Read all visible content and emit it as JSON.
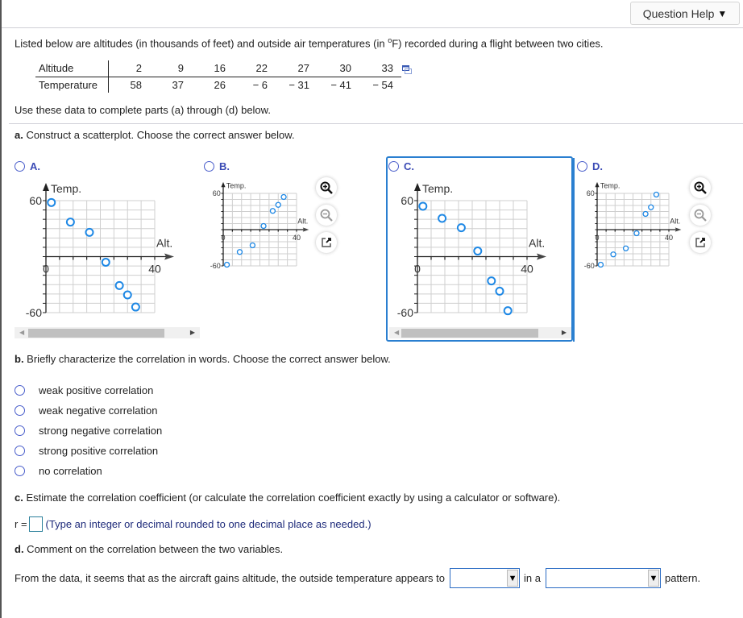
{
  "header": {
    "question_help_label": "Question Help",
    "question_help_icon": "caret-down-icon"
  },
  "intro": {
    "text_before_degree": "Listed below are altitudes (in thousands of feet) and outside air temperatures (in ",
    "degree": "o",
    "text_after_degree": "F) recorded during a flight between two cities."
  },
  "table": {
    "row_labels": [
      "Altitude",
      "Temperature"
    ],
    "altitude": [
      "2",
      "9",
      "16",
      "22",
      "27",
      "30",
      "33"
    ],
    "temperature": [
      "58",
      "37",
      "26",
      "− 6",
      "− 31",
      "− 41",
      "− 54"
    ],
    "copy_icon": "copy-data-icon"
  },
  "use_text": "Use these data to complete parts (a) through (d) below.",
  "part_a": {
    "prefix": "a.",
    "text": " Construct a scatterplot. Choose the correct answer below.",
    "options": [
      {
        "letter": "A.",
        "selected": false
      },
      {
        "letter": "B.",
        "selected": false
      },
      {
        "letter": "C.",
        "selected": false,
        "highlighted": true
      },
      {
        "letter": "D.",
        "selected": false
      }
    ],
    "zoom_in_icon": "zoom-in-icon",
    "zoom_out_icon": "zoom-out-icon",
    "popout_icon": "popout-icon"
  },
  "chart_data": [
    {
      "type": "scatter",
      "option": "A",
      "xlabel": "Alt.",
      "ylabel": "Temp.",
      "xlim": [
        0,
        40
      ],
      "ylim": [
        -60,
        60
      ],
      "grid": true,
      "xticks_labeled": [
        "0",
        "40"
      ],
      "yticks_labeled": [
        "60",
        "-60"
      ],
      "x": [
        2,
        9,
        16,
        22,
        27,
        30,
        33
      ],
      "y": [
        58,
        37,
        26,
        -6,
        -31,
        -41,
        -54
      ],
      "color": "#1e88e5"
    },
    {
      "type": "scatter",
      "option": "B",
      "xlabel": "Alt.",
      "ylabel": "Temp.",
      "xlim": [
        0,
        40
      ],
      "ylim": [
        -60,
        60
      ],
      "grid": true,
      "xticks_labeled": [
        "0",
        "40"
      ],
      "yticks_labeled": [
        "60",
        "-60"
      ],
      "x": [
        2,
        9,
        16,
        22,
        27,
        30,
        33
      ],
      "y": [
        -58,
        -37,
        -26,
        6,
        31,
        41,
        54
      ],
      "color": "#1e88e5"
    },
    {
      "type": "scatter",
      "option": "C",
      "xlabel": "Alt.",
      "ylabel": "Temp.",
      "xlim": [
        0,
        40
      ],
      "ylim": [
        -60,
        60
      ],
      "grid": true,
      "xticks_labeled": [
        "0",
        "40"
      ],
      "yticks_labeled": [
        "60",
        "-60"
      ],
      "x": [
        2,
        9,
        16,
        22,
        27,
        30,
        33
      ],
      "y": [
        54,
        41,
        31,
        6,
        -26,
        -37,
        -58
      ],
      "color": "#1e88e5"
    },
    {
      "type": "scatter",
      "option": "D",
      "xlabel": "Alt.",
      "ylabel": "Temp.",
      "xlim": [
        0,
        40
      ],
      "ylim": [
        -60,
        60
      ],
      "grid": true,
      "xticks_labeled": [
        "0",
        "40"
      ],
      "yticks_labeled": [
        "60",
        "-60"
      ],
      "x": [
        2,
        9,
        16,
        22,
        27,
        30,
        33
      ],
      "y": [
        -58,
        -41,
        -31,
        -6,
        26,
        37,
        58
      ],
      "color": "#1e88e5"
    }
  ],
  "part_b": {
    "prefix": "b.",
    "text": " Briefly characterize the correlation in words. Choose the correct answer below.",
    "options": [
      "weak positive correlation",
      "weak negative correlation",
      "strong negative correlation",
      "strong positive correlation",
      "no correlation"
    ]
  },
  "part_c": {
    "prefix": "c.",
    "text": " Estimate the correlation coefficient (or calculate the correlation coefficient exactly by using a calculator or software).",
    "r_label": "r =",
    "r_value": "",
    "hint": "(Type an integer or decimal rounded to one decimal place as needed.)"
  },
  "part_d": {
    "prefix": "d.",
    "text": " Comment on the correlation between the two variables.",
    "sentence_start": "From the data, it seems that as the aircraft gains altitude, the outside temperature appears to",
    "select1_value": "",
    "middle": "in a",
    "select2_value": "",
    "end": "pattern."
  }
}
